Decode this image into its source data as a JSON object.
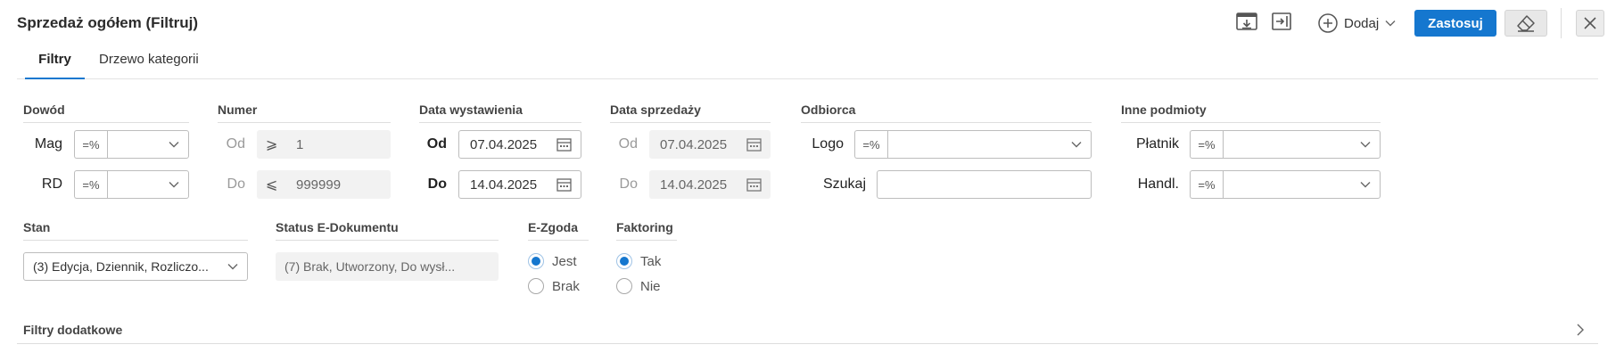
{
  "header": {
    "title": "Sprzedaż ogółem (Filtruj)",
    "add_label": "Dodaj",
    "apply_label": "Zastosuj"
  },
  "tabs": [
    {
      "label": "Filtry",
      "active": true
    },
    {
      "label": "Drzewo kategorii",
      "active": false
    }
  ],
  "dowod": {
    "title": "Dowód",
    "rows": [
      {
        "label": "Mag",
        "operator": "=%",
        "value": ""
      },
      {
        "label": "RD",
        "operator": "=%",
        "value": ""
      }
    ]
  },
  "numer": {
    "title": "Numer",
    "rows": [
      {
        "label": "Od",
        "operator": "⩾",
        "value": "1"
      },
      {
        "label": "Do",
        "operator": "⩽",
        "value": "999999"
      }
    ]
  },
  "data_wystawienia": {
    "title": "Data wystawienia",
    "rows": [
      {
        "label": "Od",
        "value": "07.04.2025"
      },
      {
        "label": "Do",
        "value": "14.04.2025"
      }
    ]
  },
  "data_sprzedazy": {
    "title": "Data sprzedaży",
    "rows": [
      {
        "label": "Od",
        "value": "07.04.2025"
      },
      {
        "label": "Do",
        "value": "14.04.2025"
      }
    ]
  },
  "odbiorca": {
    "title": "Odbiorca",
    "logo_label": "Logo",
    "logo_operator": "=%",
    "logo_value": "",
    "search_label": "Szukaj",
    "search_value": ""
  },
  "inne_podmioty": {
    "title": "Inne podmioty",
    "rows": [
      {
        "label": "Płatnik",
        "operator": "=%",
        "value": ""
      },
      {
        "label": "Handl.",
        "operator": "=%",
        "value": ""
      }
    ]
  },
  "stan": {
    "title": "Stan",
    "value": "(3) Edycja, Dziennik, Rozliczo..."
  },
  "status_edok": {
    "title": "Status E-Dokumentu",
    "value": "(7) Brak, Utworzony, Do wysł..."
  },
  "ezgoda": {
    "title": "E-Zgoda",
    "options": [
      {
        "label": "Jest",
        "checked": true
      },
      {
        "label": "Brak",
        "checked": false
      }
    ]
  },
  "faktoring": {
    "title": "Faktoring",
    "options": [
      {
        "label": "Tak",
        "checked": true
      },
      {
        "label": "Nie",
        "checked": false
      }
    ]
  },
  "more_filters": {
    "title": "Filtry dodatkowe"
  },
  "colors": {
    "accent": "#1577cf",
    "readonly_bg": "#f2f2f2"
  },
  "icons": [
    "card-download-icon",
    "panel-arrow-icon",
    "plus-circle-icon",
    "chevron-down-icon",
    "eraser-icon",
    "close-icon",
    "calendar-icon",
    "chevron-right-icon"
  ]
}
